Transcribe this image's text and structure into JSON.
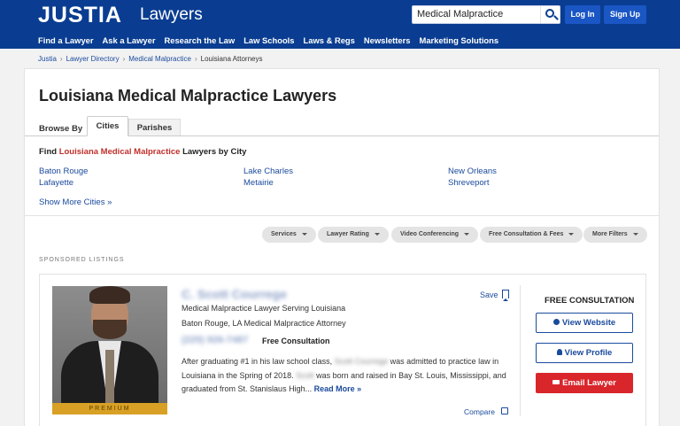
{
  "header": {
    "logo": "JUSTIA",
    "logo_sub": "Lawyers",
    "search_value": "Medical Malpractice",
    "login_label": "Log In",
    "signup_label": "Sign Up",
    "nav": [
      "Find a Lawyer",
      "Ask a Lawyer",
      "Research the Law",
      "Law Schools",
      "Laws & Regs",
      "Newsletters",
      "Marketing Solutions"
    ]
  },
  "breadcrumb": {
    "items": [
      "Justia",
      "Lawyer Directory",
      "Medical Malpractice",
      "Louisiana Attorneys"
    ],
    "separator": "›"
  },
  "page": {
    "title": "Louisiana Medical Malpractice Lawyers",
    "browse_by": "Browse By",
    "tabs": [
      "Cities",
      "Parishes"
    ],
    "find_prefix": "Find ",
    "find_highlight": "Louisiana Medical Malpractice",
    "find_suffix": " Lawyers by City",
    "cities": [
      "Baton Rouge",
      "Lafayette",
      "Lake Charles",
      "Metairie",
      "New Orleans",
      "Shreveport"
    ],
    "show_more": "Show More Cities »",
    "filters": [
      "Services",
      "Lawyer Rating",
      "Video Conferencing",
      "Free Consultation & Fees",
      "More Filters"
    ],
    "sponsored": "SPONSORED LISTINGS"
  },
  "listing": {
    "name": "C. Scott Courrege",
    "save_label": "Save",
    "tagline": "Medical Malpractice Lawyer Serving Louisiana",
    "location": "Baton Rouge, LA Medical Malpractice Attorney",
    "phone": "(225) 926-7487",
    "free_consultation": "Free Consultation",
    "bio_1": "After graduating #1 in his law school class, ",
    "bio_name_1": "Scott Courrege",
    "bio_2": " was admitted to practice law in Louisiana in the Spring of 2018. ",
    "bio_name_2": "Scott",
    "bio_3": " was born and raised in Bay St. Louis, Mississippi, and graduated from St. Stanislaus High... ",
    "read_more": "Read More »",
    "compare_label": "Compare",
    "premium_label": "PREMIUM",
    "consult_title": "FREE CONSULTATION",
    "view_website": "View Website",
    "view_profile": "View Profile",
    "email_lawyer": "Email Lawyer"
  },
  "colors": {
    "header_bg": "#0a3d91",
    "link": "#1a4a9c",
    "highlight_red": "#c0302b",
    "email_red": "#d9262b",
    "premium_gold": "#d8a024"
  }
}
